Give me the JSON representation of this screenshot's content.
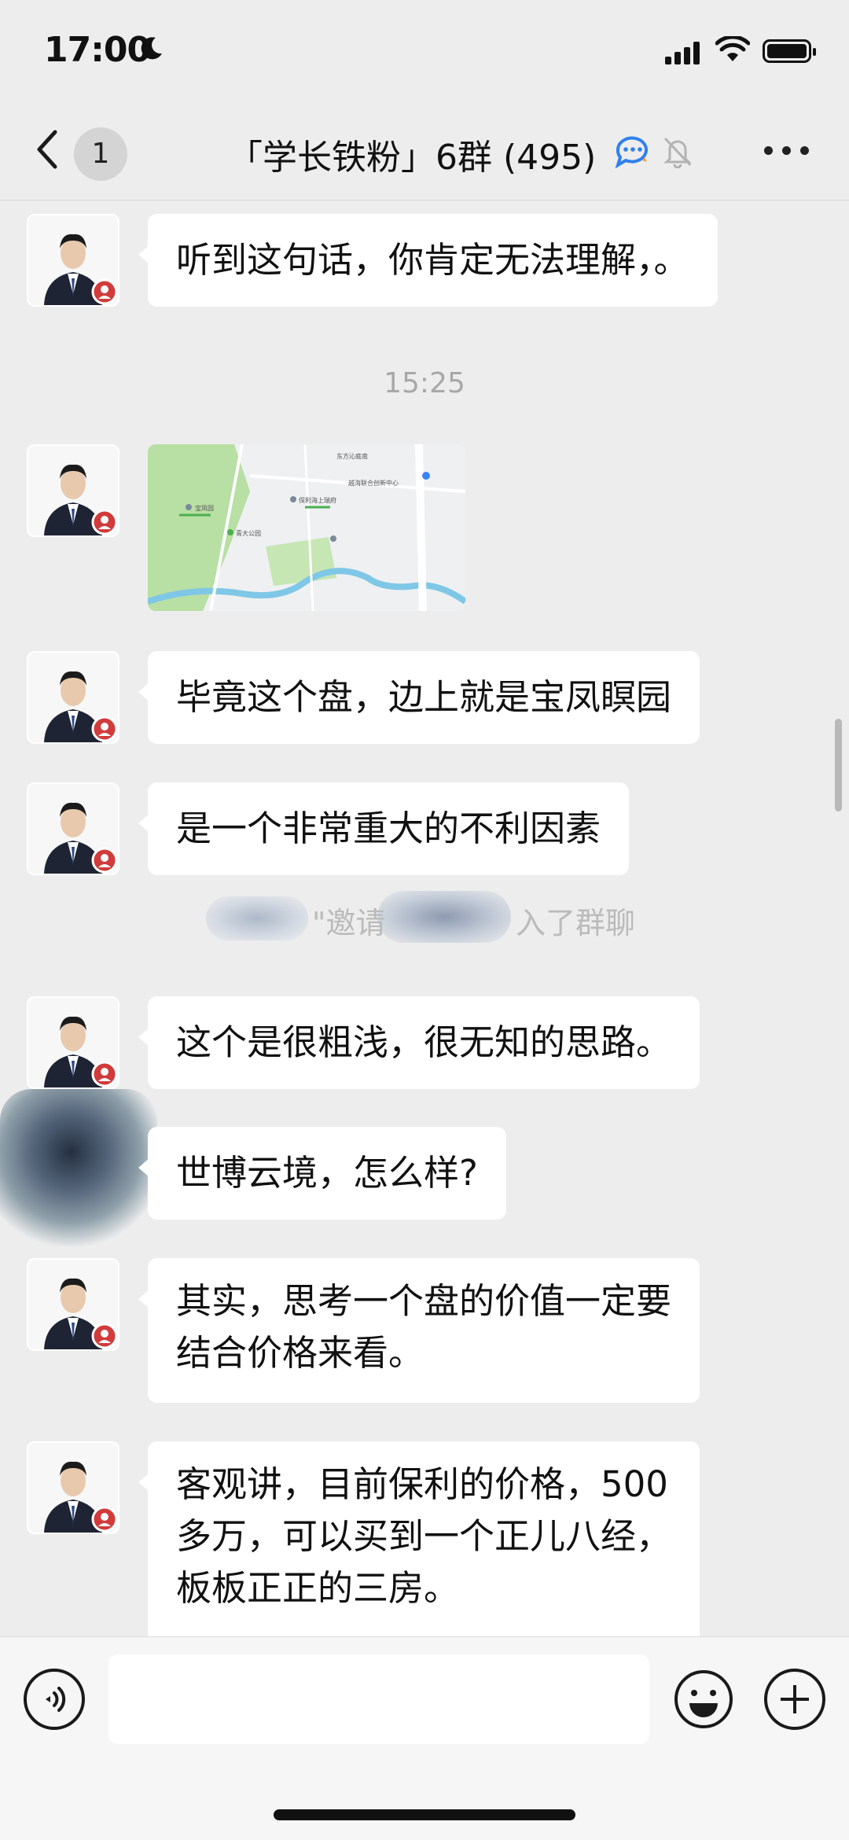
{
  "status_bar": {
    "time": "17:00",
    "icons": [
      "moon-icon",
      "signal-icon",
      "wifi-icon",
      "battery-icon"
    ]
  },
  "nav": {
    "back_icon": "chevron-left-icon",
    "unread_count": "1",
    "title": "「学长铁粉」6群 (495)",
    "icons": [
      "chat-ai-icon",
      "mute-bell-icon",
      "more-icon"
    ]
  },
  "messages": [
    {
      "type": "text",
      "text": "听到这句话，你肯定无法理解，。"
    },
    {
      "type": "time",
      "text": "15:25"
    },
    {
      "type": "map",
      "labels": [
        "东方沁庭南",
        "宝凤园",
        "保利海上瑞府",
        "青大公园",
        "越海联合创新中心"
      ]
    },
    {
      "type": "text",
      "text": "毕竟这个盘，边上就是宝凤瞑园"
    },
    {
      "type": "text",
      "text": "是一个非常重大的不利因素"
    },
    {
      "type": "system",
      "text_a": "\"邀请",
      "text_b": "入了群聊"
    },
    {
      "type": "text",
      "text": "这个是很粗浅，很无知的思路。"
    },
    {
      "type": "text",
      "text": "世博云境，怎么样?"
    },
    {
      "type": "text",
      "lines": [
        "其实，思考一个盘的价值一定要",
        "结合价格来看。"
      ]
    },
    {
      "type": "text",
      "lines": [
        "客观讲，目前保利的价格，500",
        "多万，可以买到一个正儿八经，",
        "板板正正的三房。"
      ]
    }
  ],
  "input_bar": {
    "icons": [
      "voice-icon",
      "emoji-icon",
      "plus-icon"
    ],
    "value": ""
  },
  "colors": {
    "background": "#ededed",
    "bubble": "#ffffff",
    "timestamp": "#a8a8a8"
  }
}
